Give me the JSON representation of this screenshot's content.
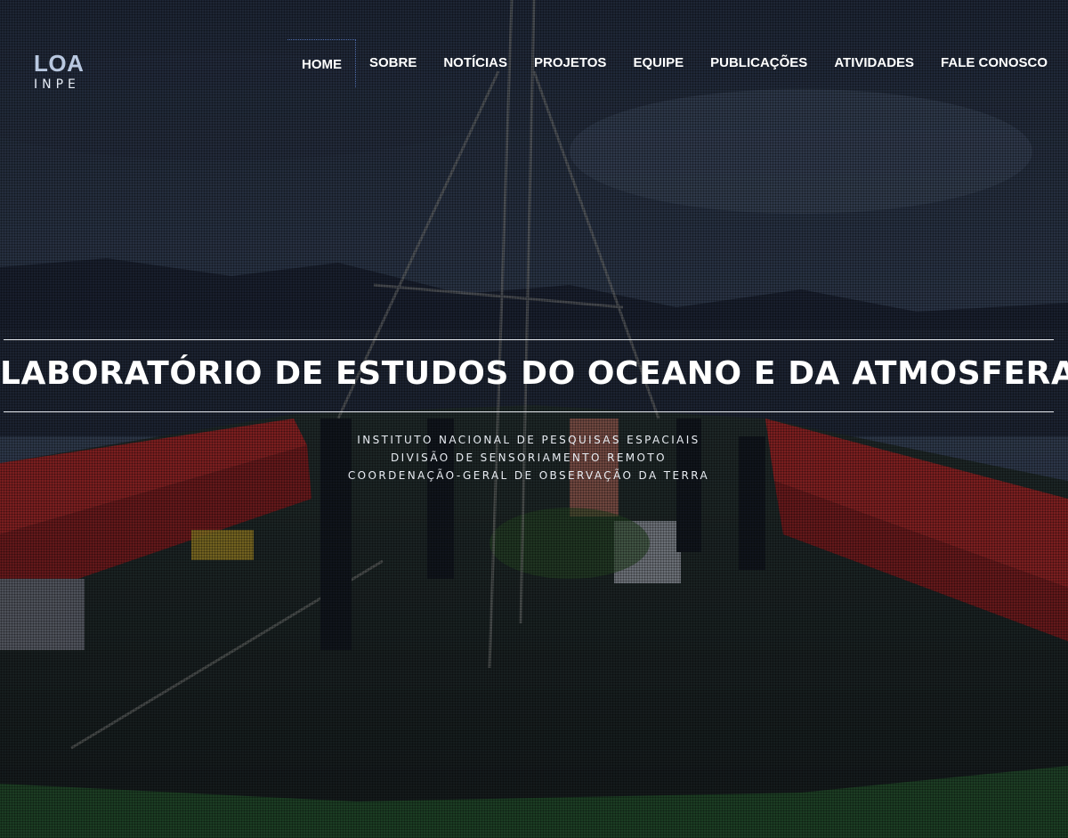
{
  "brand": {
    "name": "LOA",
    "sub": "INPE"
  },
  "nav": {
    "items": [
      {
        "label": "HOME",
        "active": true
      },
      {
        "label": "SOBRE"
      },
      {
        "label": "NOTÍCIAS"
      },
      {
        "label": "PROJETOS"
      },
      {
        "label": "EQUIPE"
      },
      {
        "label": "PUBLICAÇÕES"
      },
      {
        "label": "ATIVIDADES"
      },
      {
        "label": "FALE CONOSCO"
      }
    ]
  },
  "hero": {
    "title": "LABORATÓRIO DE ESTUDOS DO OCEANO E DA ATMOSFERA",
    "lines": [
      "INSTITUTO NACIONAL DE PESQUISAS ESPACIAIS",
      "DIVISÃO DE SENSORIAMENTO REMOTO",
      "COORDENAÇÃO-GERAL DE OBSERVAÇÃO DA TERRA"
    ]
  },
  "colors": {
    "accent": "#b9c8e0",
    "active_border": "#4d6aa8",
    "hull": "#b3261f",
    "deck": "#1f2a22"
  }
}
